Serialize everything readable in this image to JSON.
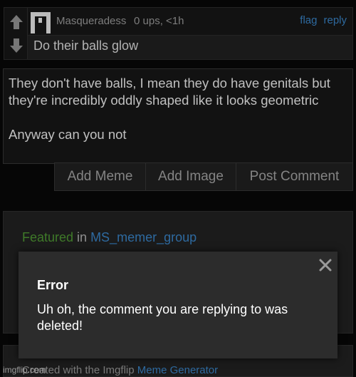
{
  "comment": {
    "username": "Masqueradess",
    "meta": "0 ups, <1h",
    "flag_label": "flag",
    "reply_label": "reply",
    "text": "Do their balls glow"
  },
  "reply_draft": {
    "text": "They don't have balls, I mean they do have genitals but they're incredibly oddly shaped like it looks geometric\n\nAnyway can you not"
  },
  "reply_buttons": [
    "Add Meme",
    "Add Image",
    "Post Comment"
  ],
  "featured": {
    "prefix": "Featured",
    "connector": " in ",
    "group": "MS_memer_group"
  },
  "footer": {
    "created_text": "Created with the Imgflip ",
    "generator_link": "Meme Generator"
  },
  "watermark": "imgflip.com",
  "error_dialog": {
    "title": "Error",
    "message": "Uh oh, the comment you are replying to was deleted!"
  },
  "icons": {
    "upvote": "upvote-arrow-icon",
    "downvote": "downvote-arrow-icon",
    "avatar": "avatar-icon",
    "close": "close-icon"
  },
  "colors": {
    "link_blue": "#2e6aa0",
    "featured_green": "#3f7a29",
    "background": "#060606",
    "dialog": "#2c2c2c"
  }
}
